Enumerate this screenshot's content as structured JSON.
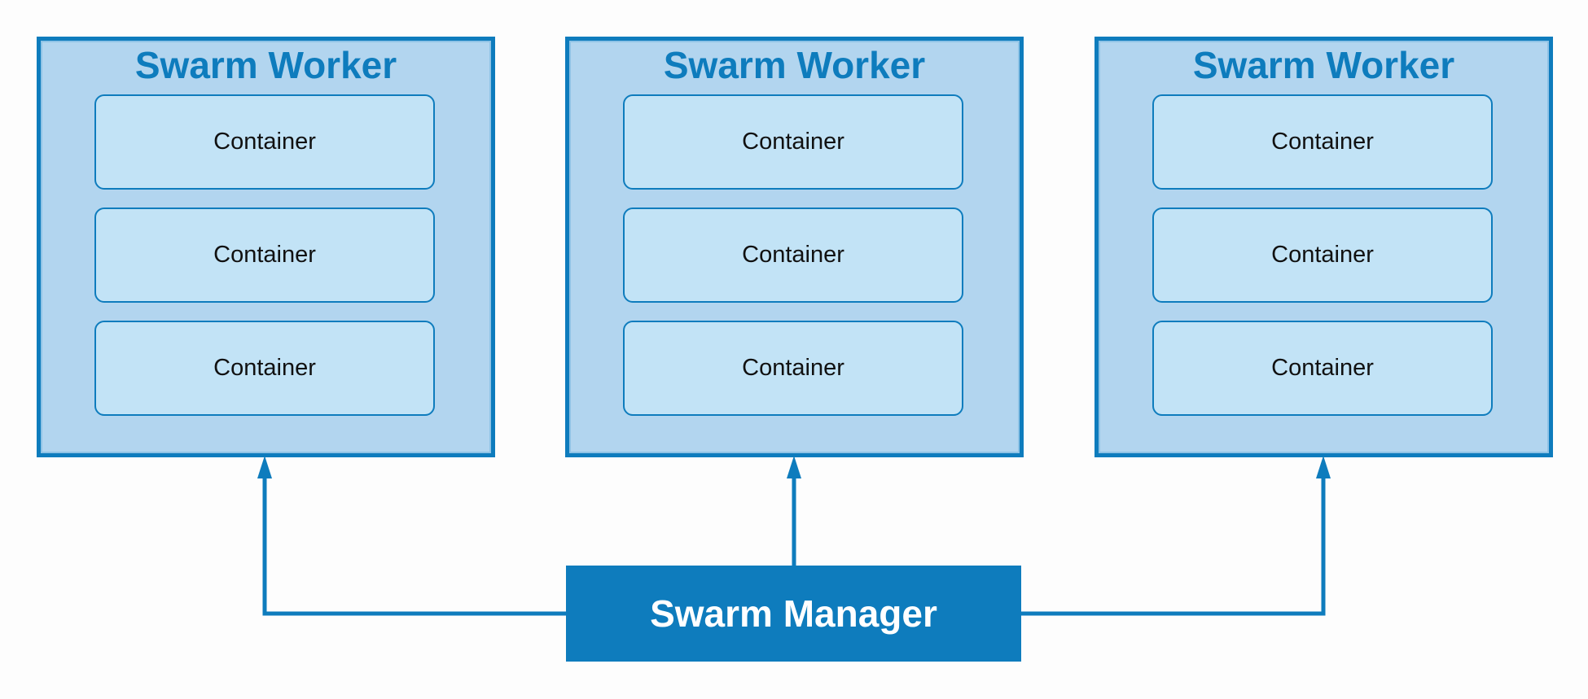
{
  "workers": [
    {
      "title": "Swarm Worker",
      "containers": [
        "Container",
        "Container",
        "Container"
      ]
    },
    {
      "title": "Swarm Worker",
      "containers": [
        "Container",
        "Container",
        "Container"
      ]
    },
    {
      "title": "Swarm Worker",
      "containers": [
        "Container",
        "Container",
        "Container"
      ]
    }
  ],
  "manager": {
    "label": "Swarm Manager"
  },
  "colors": {
    "accent": "#0e7cbd",
    "worker_fill": "#b2d5ef",
    "container_fill": "#c2e3f6"
  }
}
